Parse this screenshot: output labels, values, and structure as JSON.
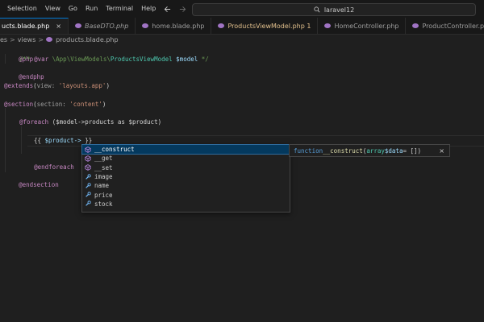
{
  "menu": [
    "Selection",
    "View",
    "Go",
    "Run",
    "Terminal",
    "Help"
  ],
  "command_center": {
    "text": "laravel12"
  },
  "tabs": [
    {
      "label": "ucts.blade.php",
      "active": true,
      "close": "×"
    },
    {
      "label": "BaseDTO.php",
      "italic": true
    },
    {
      "label": "home.blade.php"
    },
    {
      "label": "ProductsViewModel.php 1",
      "modified": true
    },
    {
      "label": "HomeController.php"
    },
    {
      "label": "ProductController.php"
    }
  ],
  "breadcrumb": {
    "part1": "es",
    "part2": "views",
    "part3": "products.blade.php"
  },
  "code": {
    "line1_dir": "@php",
    "line2_comment_a": "/** ",
    "line2_var_tag": "@var",
    "line2_comment_b": " \\App\\ViewModels\\",
    "line2_class": "ProductsViewModel",
    "line2_var": " $model",
    "line2_end": " */",
    "line3_dir": "@endphp",
    "line5_dir": "@extends",
    "line5_open": "(",
    "line5_hint": "view: ",
    "line5_str": "'layouts.app'",
    "line5_close": ")",
    "line7_dir": "@section",
    "line7_open": "(",
    "line7_hint": "section: ",
    "line7_str": "'content'",
    "line7_close": ")",
    "line9_dir": "@foreach",
    "line9_rest": " ($model->products as $product)",
    "line11_open": "{{ ",
    "line11_expr": "$product->",
    "line11_close": " }}",
    "line12_dir": "@endforeach",
    "line14_dir": "@endsection"
  },
  "suggestions": [
    {
      "label": "__construct",
      "kind": "method",
      "selected": true
    },
    {
      "label": "__get",
      "kind": "method"
    },
    {
      "label": "__set",
      "kind": "method"
    },
    {
      "label": "image",
      "kind": "property"
    },
    {
      "label": "name",
      "kind": "property"
    },
    {
      "label": "price",
      "kind": "property"
    },
    {
      "label": "stock",
      "kind": "property"
    }
  ],
  "details": {
    "keyword": "function",
    "name": " __construct",
    "open": "(",
    "type": "array",
    "var": " $data",
    "rest": " = [])",
    "close": "×"
  },
  "colors": {
    "method_icon": "#b180d7",
    "property_icon": "#75beff",
    "accent": "#0078d4"
  }
}
